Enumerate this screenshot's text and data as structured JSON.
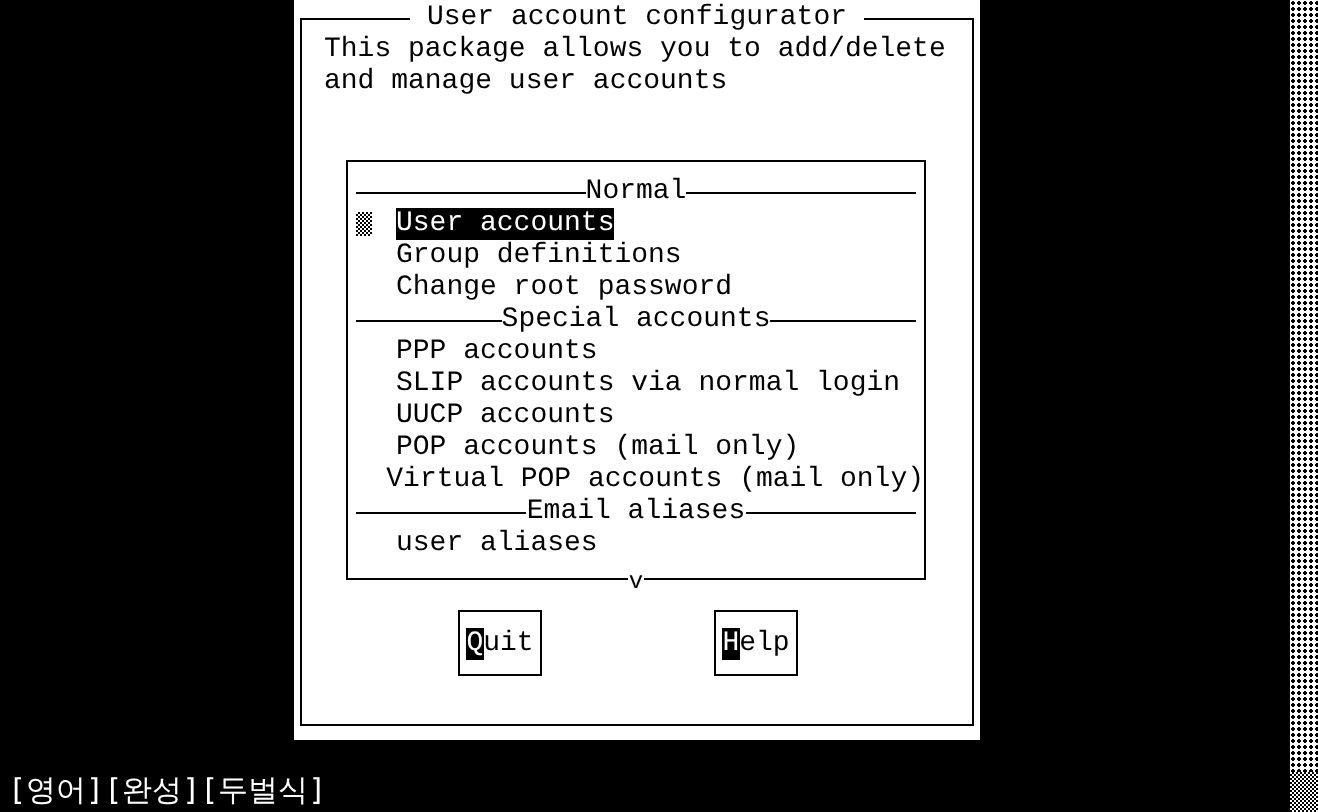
{
  "dialog": {
    "title": "User account configurator",
    "description": [
      "This package allows you to add/delete",
      "and manage user accounts"
    ]
  },
  "menu": {
    "sections": [
      {
        "title": "Normal",
        "items": [
          {
            "label": "User accounts",
            "selected": true
          },
          {
            "label": "Group definitions",
            "selected": false
          },
          {
            "label": "Change root password",
            "selected": false
          }
        ]
      },
      {
        "title": "Special accounts",
        "items": [
          {
            "label": "PPP accounts",
            "selected": false
          },
          {
            "label": "SLIP accounts via normal login",
            "selected": false
          },
          {
            "label": "UUCP accounts",
            "selected": false
          },
          {
            "label": "POP accounts (mail only)",
            "selected": false
          },
          {
            "label": "Virtual POP accounts (mail only)",
            "selected": false
          }
        ]
      },
      {
        "title": "Email aliases",
        "items": [
          {
            "label": "user aliases",
            "selected": false
          }
        ]
      }
    ],
    "more_indicator": "v"
  },
  "buttons": [
    "Quit",
    "Help"
  ],
  "status_bar": [
    "[영어]",
    "[완성]",
    "[두벌식]"
  ]
}
